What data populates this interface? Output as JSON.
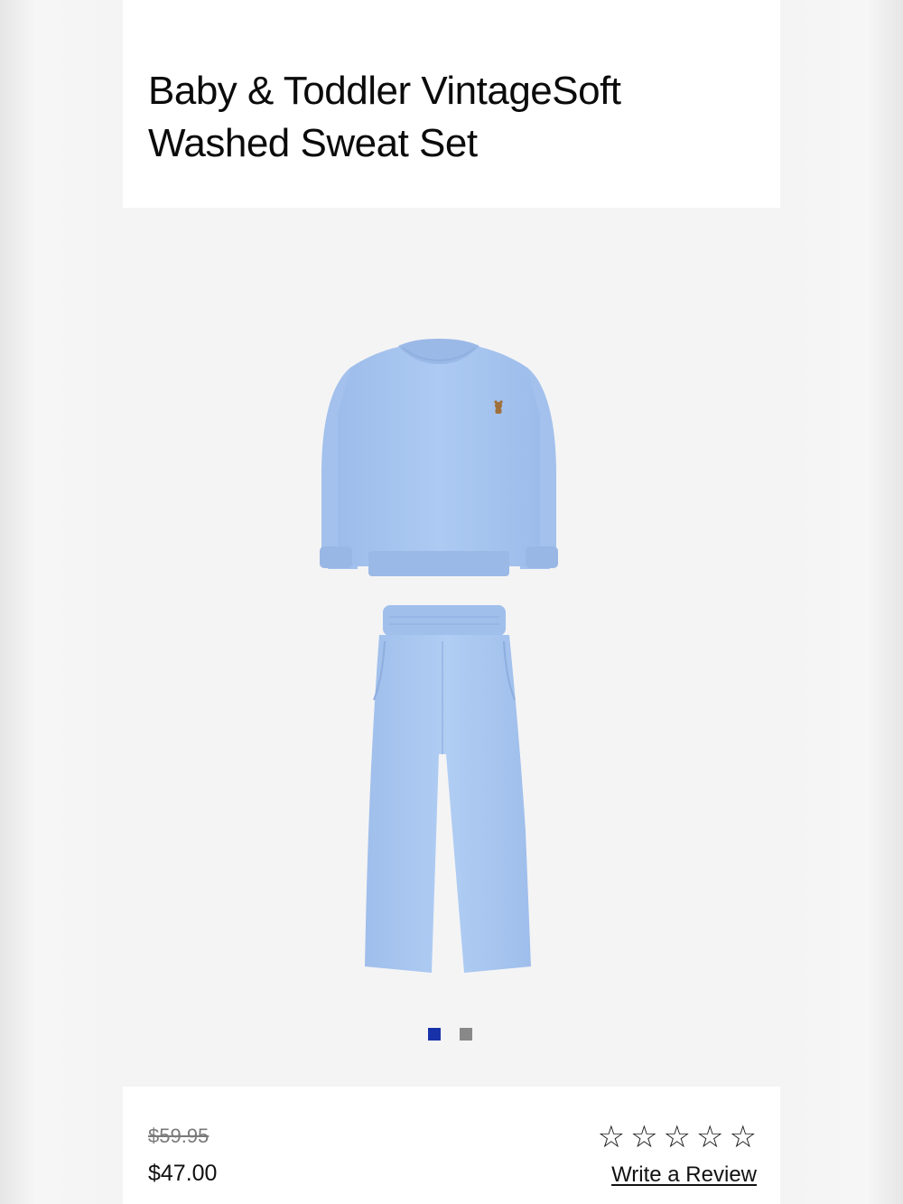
{
  "product": {
    "title": "Baby & Toddler VintageSoft Washed Sweat Set",
    "image_alt": "Light blue sweatshirt and sweatpants set",
    "color_hex": "#a9c6ee"
  },
  "gallery": {
    "slides_total": 2,
    "active_slide": 1
  },
  "pricing": {
    "original": "$59.95",
    "sale": "$47.00"
  },
  "rating": {
    "stars": [
      "☆",
      "☆",
      "☆",
      "☆",
      "☆"
    ],
    "write_review": "Write a Review"
  },
  "colors": {
    "active_dot": "#1732a8",
    "inactive_dot": "#888888",
    "gallery_bg": "#f4f4f5"
  }
}
